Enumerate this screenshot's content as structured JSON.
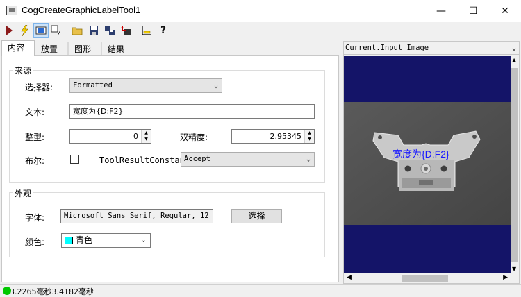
{
  "window": {
    "title": "CogCreateGraphicLabelTool1",
    "minimize_glyph": "—",
    "maximize_glyph": "☐",
    "close_glyph": "✕"
  },
  "toolbar": {
    "icons": [
      "run-icon",
      "electric-icon",
      "show-image-icon",
      "help-context-icon",
      "open-icon",
      "save-icon",
      "save-as-icon",
      "reset-icon",
      "measure-icon",
      "help-icon"
    ]
  },
  "tabs": [
    "内容",
    "放置",
    "图形",
    "结果"
  ],
  "source": {
    "legend": "来源",
    "selector_label": "选择器:",
    "selector_value": "Formatted",
    "text_label": "文本:",
    "text_value": "宽度为{D:F2}",
    "integer_label": "整型:",
    "integer_value": "0",
    "double_label": "双精度:",
    "double_value": "2.95345",
    "bool_label": "布尔:",
    "bool_checked": false,
    "trc_label": "ToolResultConstant:",
    "trc_value": "Accept"
  },
  "appearance": {
    "legend": "外观",
    "font_label": "字体:",
    "font_value": "Microsoft Sans Serif, Regular, 12",
    "choose_button": "选择",
    "color_label": "颜色:",
    "color_value": "青色",
    "color_swatch": "#00ffff"
  },
  "image_panel": {
    "header": "Current.Input Image",
    "overlay_text": "宽度为{D:F2}",
    "overlay_color": "#1a1aff",
    "background_color": "#141468"
  },
  "status": {
    "indicator_color": "#00c800",
    "text": "3.2265毫秒3.4182毫秒"
  }
}
